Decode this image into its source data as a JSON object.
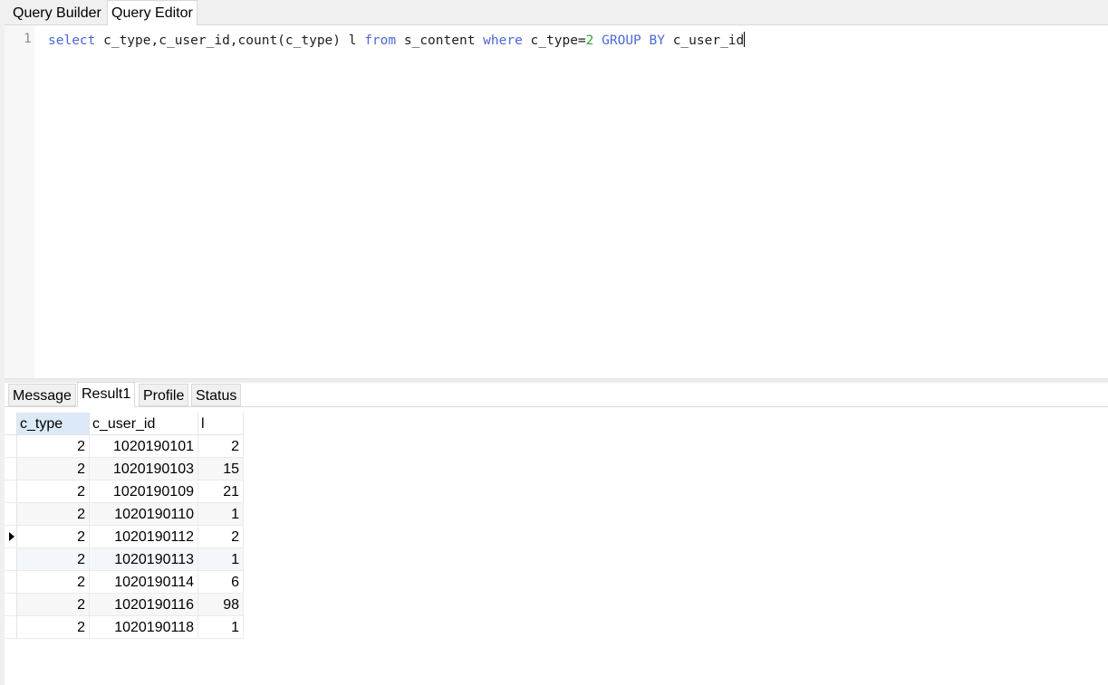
{
  "top_tabs": [
    {
      "label": "Query Builder",
      "active": false
    },
    {
      "label": "Query Editor",
      "active": true
    }
  ],
  "editor": {
    "line_number": "1",
    "tokens": {
      "kw_select": "select",
      "t1": " c_type,c_user_id,count(c_type) l ",
      "kw_from": "from",
      "t2": " s_content ",
      "kw_where": "where",
      "t3": " c_type=",
      "num_2": "2",
      "t4": " ",
      "kw_group_by": "GROUP BY",
      "t5": " c_user_id"
    }
  },
  "bottom_tabs": [
    {
      "label": "Message",
      "active": false
    },
    {
      "label": "Result1",
      "active": true
    },
    {
      "label": "Profile",
      "active": false
    },
    {
      "label": "Status",
      "active": false
    }
  ],
  "grid": {
    "columns": [
      "c_type",
      "c_user_id",
      "l"
    ],
    "rows": [
      [
        "2",
        "1020190101",
        "2"
      ],
      [
        "2",
        "1020190103",
        "15"
      ],
      [
        "2",
        "1020190109",
        "21"
      ],
      [
        "2",
        "1020190110",
        "1"
      ],
      [
        "2",
        "1020190112",
        "2"
      ],
      [
        "2",
        "1020190113",
        "1"
      ],
      [
        "2",
        "1020190114",
        "6"
      ],
      [
        "2",
        "1020190116",
        "98"
      ],
      [
        "2",
        "1020190118",
        "1"
      ]
    ],
    "current_row_index": 4
  }
}
